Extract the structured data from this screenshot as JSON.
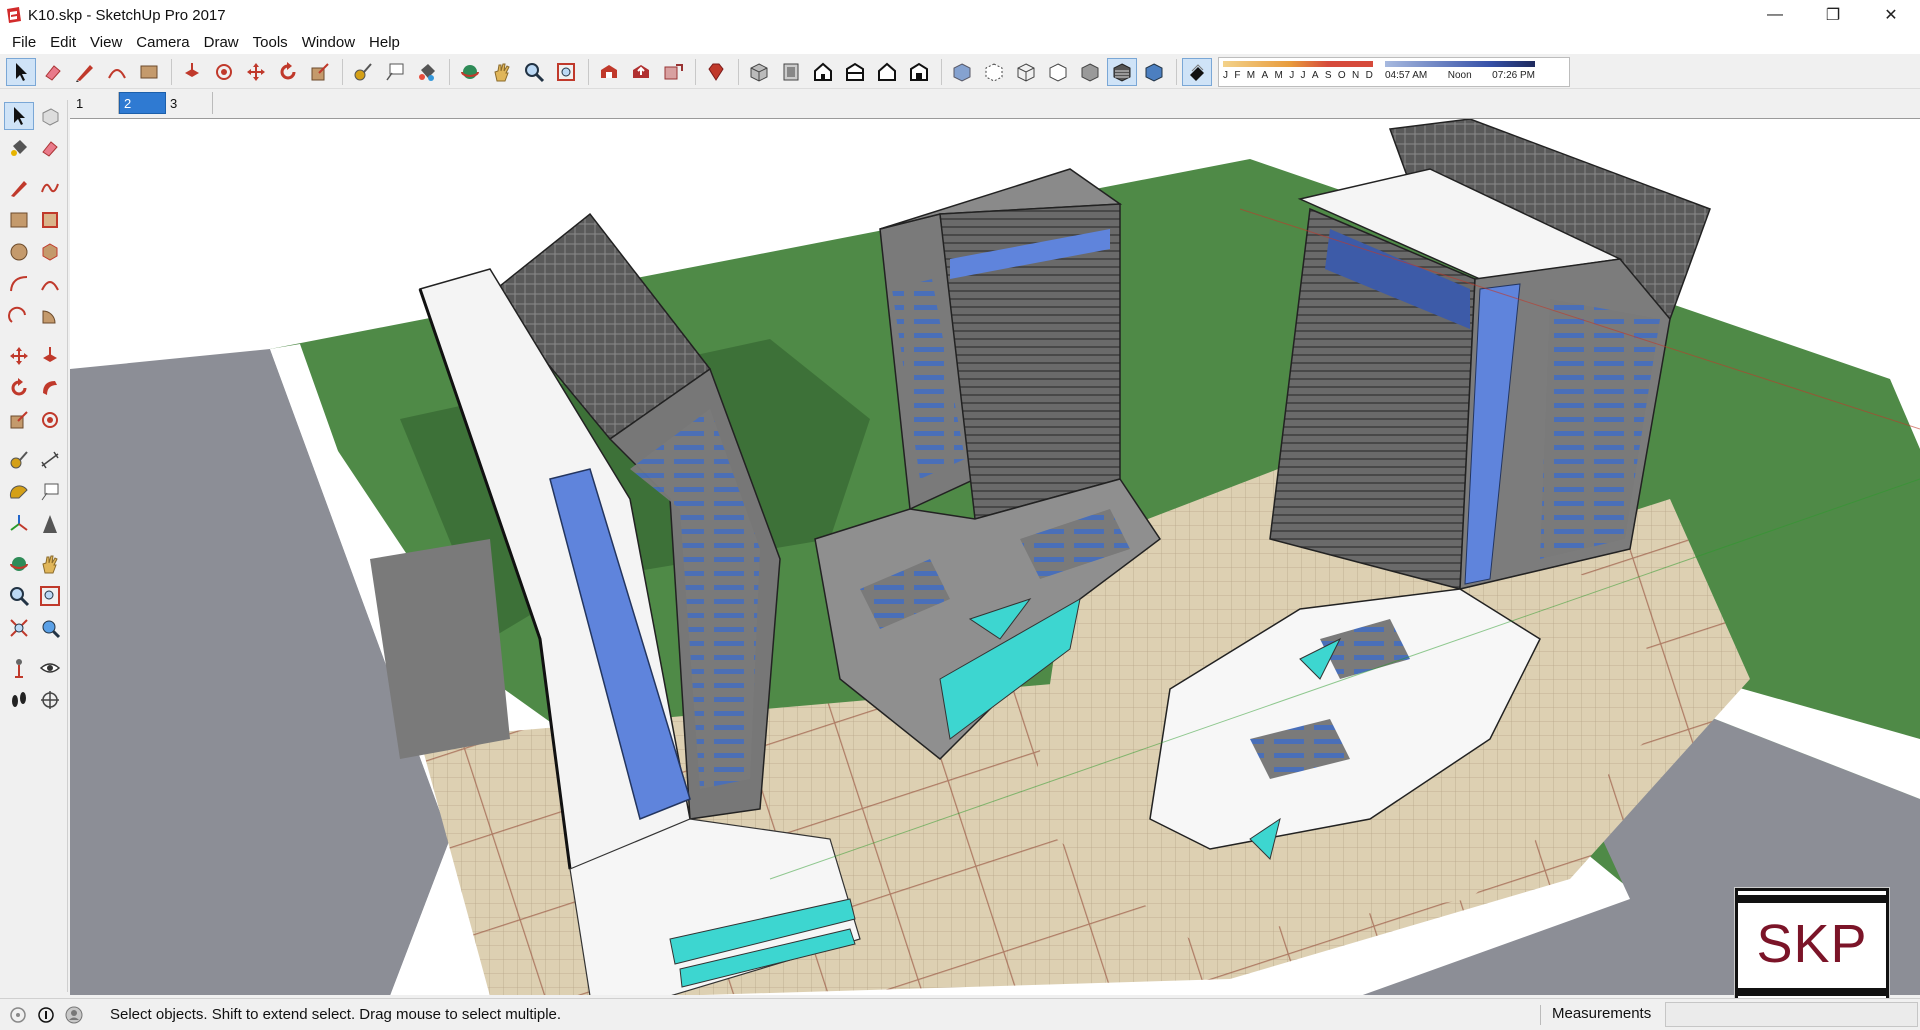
{
  "window": {
    "title": "K10.skp - SketchUp Pro 2017",
    "minimize": "—",
    "maximize": "❐",
    "close": "✕"
  },
  "menu": [
    "File",
    "Edit",
    "View",
    "Camera",
    "Draw",
    "Tools",
    "Window",
    "Help"
  ],
  "shadow": {
    "months": [
      "J",
      "F",
      "M",
      "A",
      "M",
      "J",
      "J",
      "A",
      "S",
      "O",
      "N",
      "D"
    ],
    "times": [
      "04:57 AM",
      "Noon",
      "07:26 PM"
    ]
  },
  "scenes": [
    {
      "label": "1",
      "active": false
    },
    {
      "label": "2",
      "active": true
    },
    {
      "label": "3",
      "active": false
    }
  ],
  "statusbar": {
    "message": "Select objects. Shift to extend select. Drag mouse to select multiple.",
    "measurements_label": "Measurements",
    "measurements_value": ""
  },
  "watermark": {
    "text": "SKP"
  },
  "colors": {
    "accent": "#2f7ad2",
    "grass": "#4f8a47",
    "road": "#8c8e96",
    "plaza": "#d8c6a4",
    "building_gray": "#6f6f6f",
    "glass_blue": "#5f84dc",
    "cyan": "#3dd6d0",
    "skp_red": "#7b1428"
  }
}
